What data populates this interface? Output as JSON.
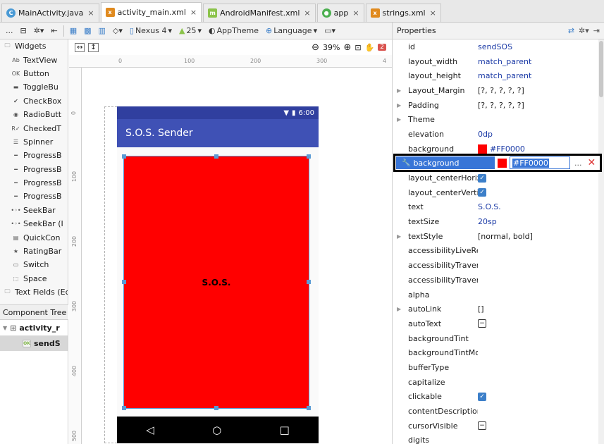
{
  "tabs": [
    {
      "label": "MainActivity.java",
      "icon": "class-icon",
      "active": false
    },
    {
      "label": "activity_main.xml",
      "icon": "xml-icon",
      "active": true
    },
    {
      "label": "AndroidManifest.xml",
      "icon": "manifest-icon",
      "active": false
    },
    {
      "label": "app",
      "icon": "module-icon",
      "active": false
    },
    {
      "label": "strings.xml",
      "icon": "xml-icon",
      "active": false
    }
  ],
  "toolbar": {
    "overflow": "...",
    "device": "Nexus 4",
    "api": "25",
    "theme": "AppTheme",
    "language": "Language"
  },
  "canvas": {
    "zoom": "39%",
    "warnings": "2",
    "ruler_top": [
      "0",
      "100",
      "200",
      "300",
      "4"
    ],
    "ruler_left": [
      "0",
      "100",
      "200",
      "300",
      "400",
      "500"
    ]
  },
  "palette": {
    "widgets_header": "Widgets",
    "items": [
      {
        "label": "TextView",
        "icon": "Ab"
      },
      {
        "label": "Button",
        "icon": "OK"
      },
      {
        "label": "ToggleBu",
        "icon": "▬"
      },
      {
        "label": "CheckBox",
        "icon": "✔"
      },
      {
        "label": "RadioButt",
        "icon": "◉"
      },
      {
        "label": "CheckedT",
        "icon": "R✓"
      },
      {
        "label": "Spinner",
        "icon": "☰"
      },
      {
        "label": "ProgressB",
        "icon": "━"
      },
      {
        "label": "ProgressB",
        "icon": "━"
      },
      {
        "label": "ProgressB",
        "icon": "━"
      },
      {
        "label": "ProgressB",
        "icon": "━"
      },
      {
        "label": "SeekBar",
        "icon": "•◦•"
      },
      {
        "label": "SeekBar (I",
        "icon": "•◦•"
      },
      {
        "label": "QuickCon",
        "icon": "▤"
      },
      {
        "label": "RatingBar",
        "icon": "★"
      },
      {
        "label": "Switch",
        "icon": "▭"
      },
      {
        "label": "Space",
        "icon": "⬚"
      }
    ],
    "text_fields_header": "Text Fields (Ec"
  },
  "component_tree": {
    "header": "Component Tree",
    "root": "activity_r",
    "child": "sendS"
  },
  "phone": {
    "time": "6:00",
    "app_title": "S.O.S. Sender",
    "button_text": "S.O.S.",
    "nav": [
      "◁",
      "○",
      "□"
    ]
  },
  "properties": {
    "header": "Properties",
    "rows": [
      {
        "name": "id",
        "value": "sendSOS",
        "kind": "text"
      },
      {
        "name": "layout_width",
        "value": "match_parent",
        "kind": "text"
      },
      {
        "name": "layout_height",
        "value": "match_parent",
        "kind": "text"
      },
      {
        "name": "Layout_Margin",
        "value": "[?, ?, ?, ?, ?]",
        "kind": "plain",
        "expander": true
      },
      {
        "name": "Padding",
        "value": "[?, ?, ?, ?, ?]",
        "kind": "plain",
        "expander": true
      },
      {
        "name": "Theme",
        "value": "",
        "kind": "plain",
        "expander": true
      },
      {
        "name": "elevation",
        "value": "0dp",
        "kind": "text"
      },
      {
        "name": "background",
        "value": "#FF0000",
        "kind": "color"
      },
      {
        "name": "",
        "value": "",
        "kind": "spacer"
      },
      {
        "name": "layout_centerHorizontal",
        "value": "",
        "kind": "check"
      },
      {
        "name": "layout_centerVertical",
        "value": "",
        "kind": "check"
      },
      {
        "name": "text",
        "value": "S.O.S.",
        "kind": "text"
      },
      {
        "name": "textSize",
        "value": "20sp",
        "kind": "text"
      },
      {
        "name": "textStyle",
        "value": "[normal, bold]",
        "kind": "plain",
        "expander": true
      },
      {
        "name": "accessibilityLiveRegion",
        "value": "",
        "kind": "plain"
      },
      {
        "name": "accessibilityTraversalAfte",
        "value": "",
        "kind": "plain"
      },
      {
        "name": "accessibilityTraversalBefo",
        "value": "",
        "kind": "plain"
      },
      {
        "name": "alpha",
        "value": "",
        "kind": "plain"
      },
      {
        "name": "autoLink",
        "value": "[]",
        "kind": "plain",
        "expander": true
      },
      {
        "name": "autoText",
        "value": "",
        "kind": "flag"
      },
      {
        "name": "backgroundTint",
        "value": "",
        "kind": "plain"
      },
      {
        "name": "backgroundTintMode",
        "value": "",
        "kind": "plain"
      },
      {
        "name": "bufferType",
        "value": "",
        "kind": "plain"
      },
      {
        "name": "capitalize",
        "value": "",
        "kind": "plain"
      },
      {
        "name": "clickable",
        "value": "",
        "kind": "check"
      },
      {
        "name": "contentDescription",
        "value": "",
        "kind": "plain"
      },
      {
        "name": "cursorVisible",
        "value": "",
        "kind": "flag"
      },
      {
        "name": "digits",
        "value": "",
        "kind": "plain"
      }
    ],
    "editing": {
      "name": "background",
      "value": "#FF0000",
      "dots": "...",
      "close": "✕"
    }
  },
  "colors": {
    "accent": "#3f51b5",
    "status": "#303f9f",
    "button": "#ff0000",
    "selection": "#3875d7"
  }
}
